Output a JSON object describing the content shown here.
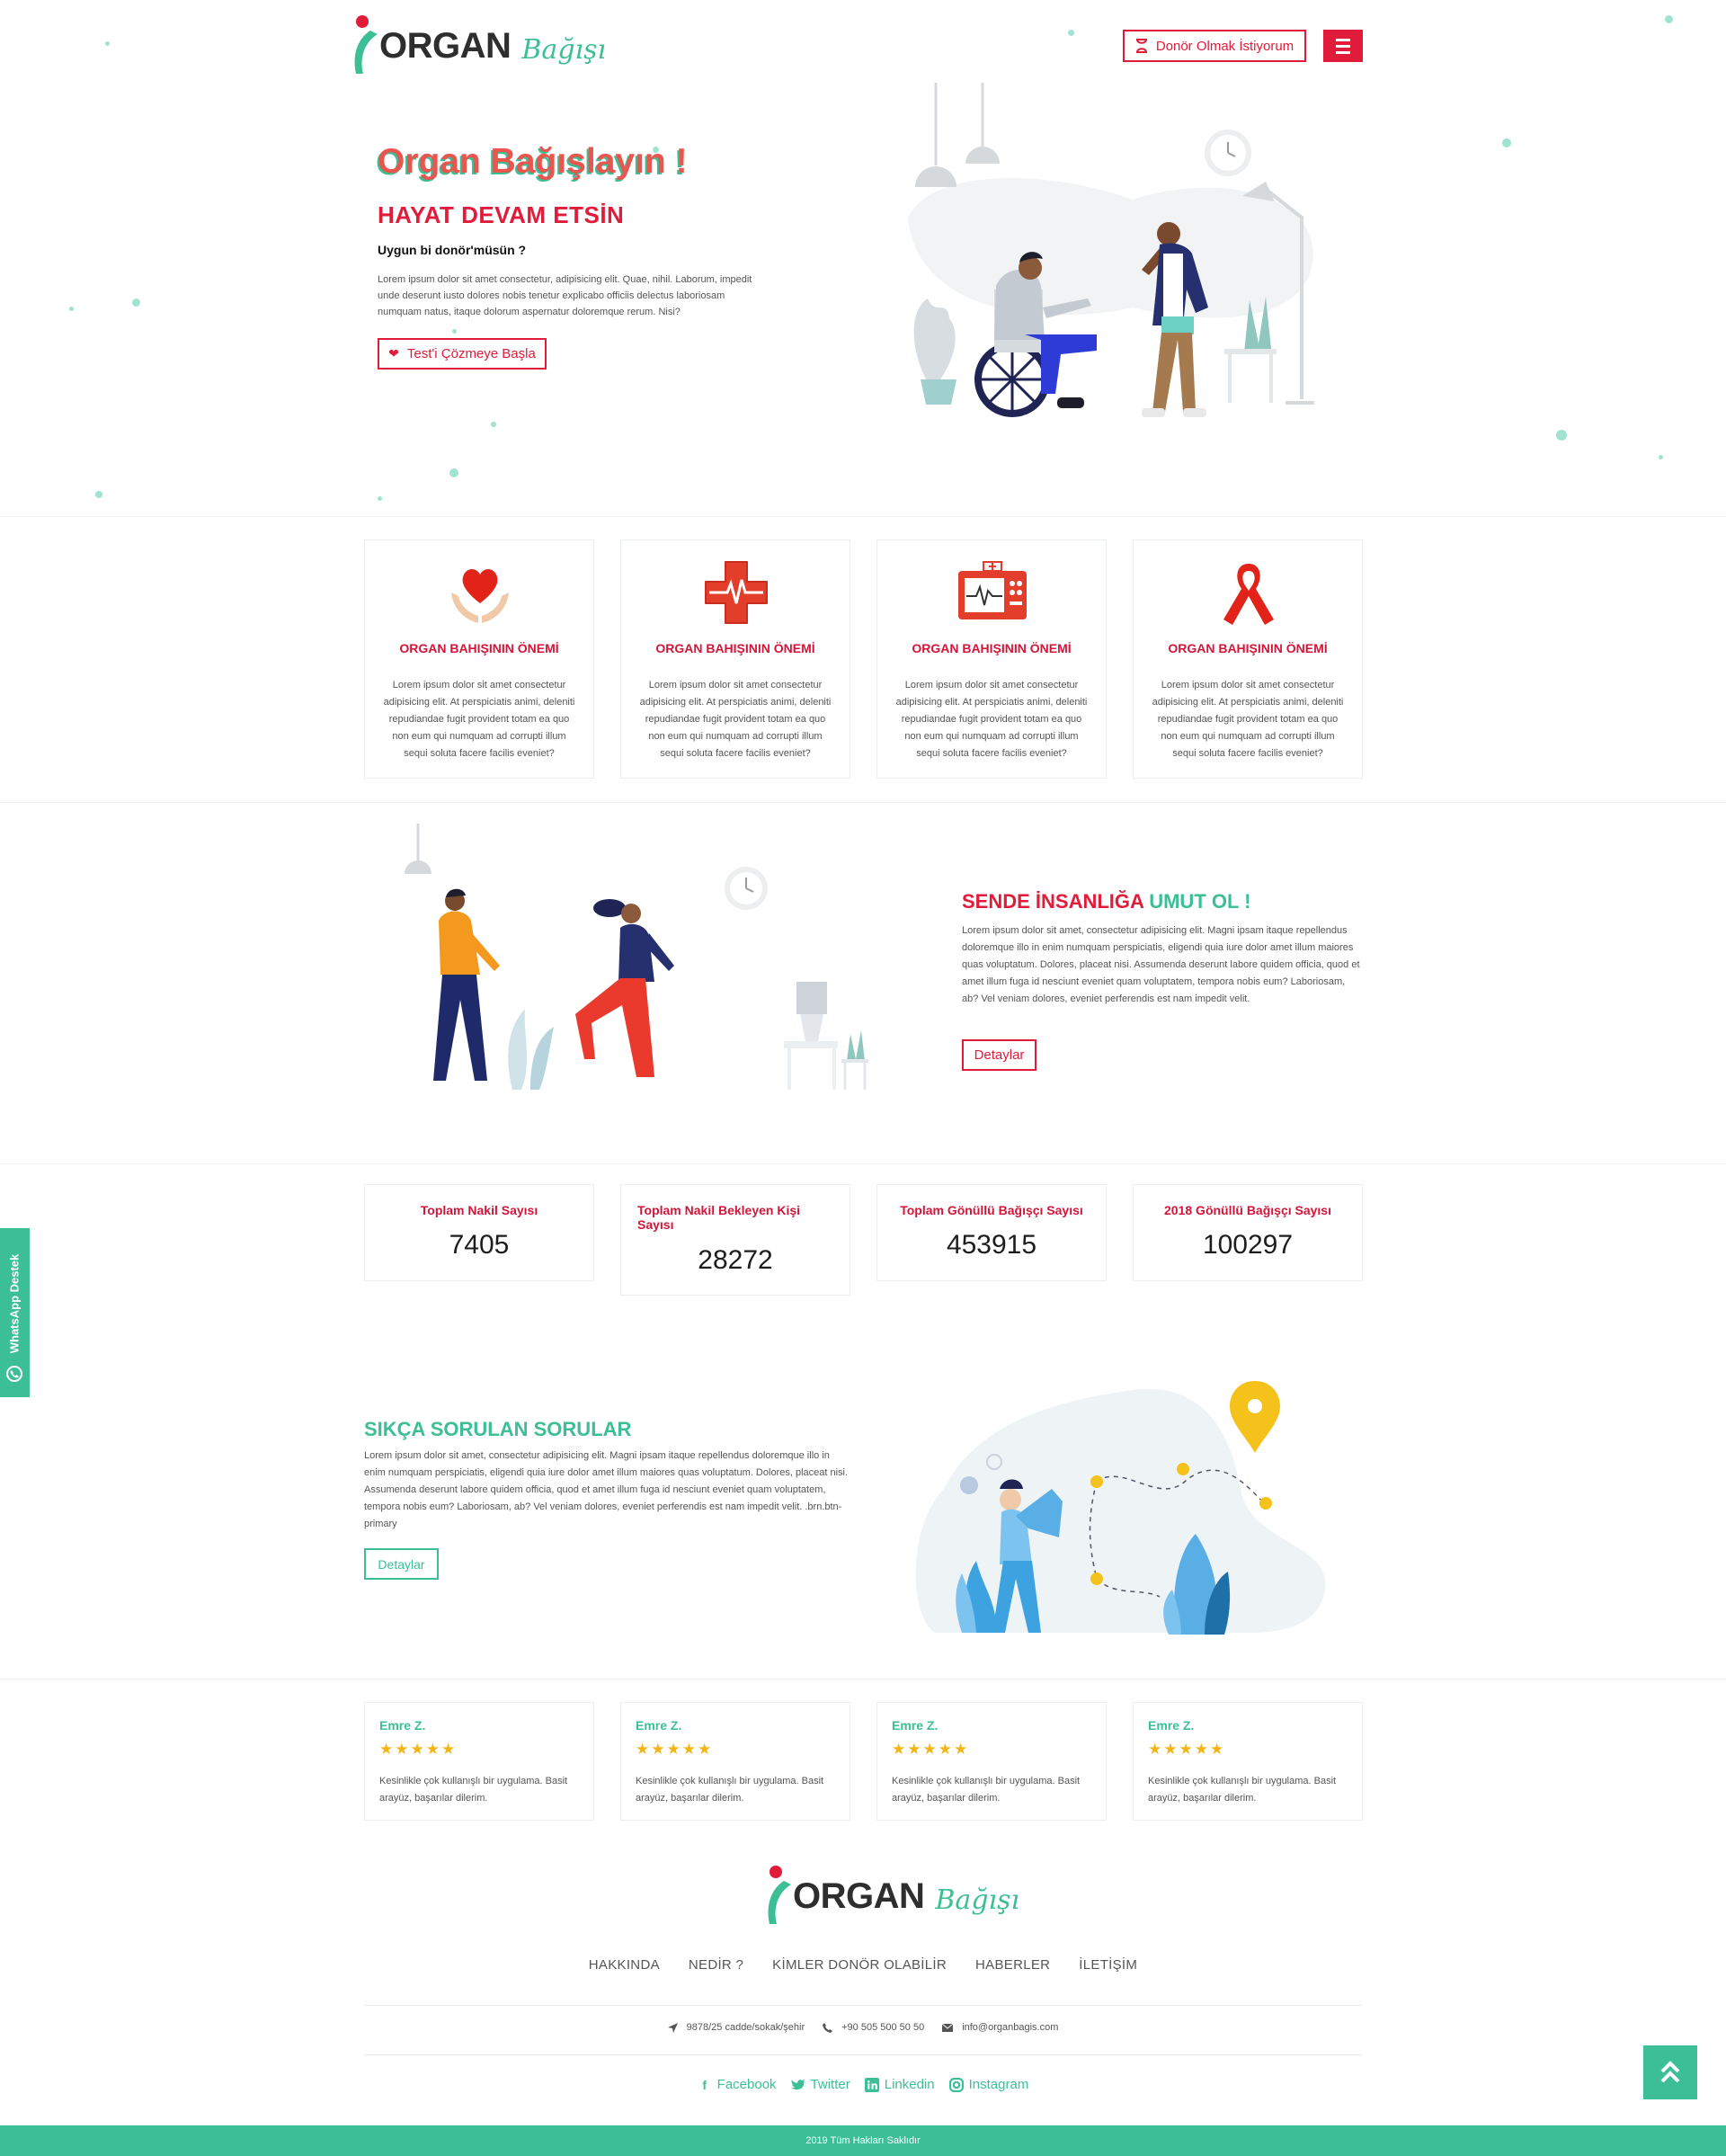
{
  "header": {
    "logo_word": "ORGAN",
    "logo_script": "Bağışı",
    "donor_button": "Donör Olmak İstiyorum",
    "colors": {
      "brand_red": "#e11b3a",
      "brand_green": "#3cbf95"
    }
  },
  "hero": {
    "title": "Organ Bağışlayın !",
    "subtitle": "HAYAT DEVAM ETSİN",
    "question": "Uygun bi donör'müsün ?",
    "paragraph": "Lorem ipsum dolor sit amet consectetur, adipisicing elit. Quae, nihil. Laborum, impedit unde deserunt iusto dolores nobis tenetur explicabo officiis delectus laboriosam numquam natus, itaque dolorum aspernatur doloremque rerum. Nisi?",
    "cta": "Test'i Çözmeye Başla"
  },
  "features": [
    {
      "icon": "heart-hands-icon",
      "title": "ORGAN BAHIŞININ ÖNEMİ",
      "text": "Lorem ipsum dolor sit amet consectetur adipisicing elit. At perspiciatis animi, deleniti repudiandae fugit provident totam ea quo non eum qui numquam ad corrupti illum sequi soluta facere facilis eveniet?"
    },
    {
      "icon": "medical-cross-icon",
      "title": "ORGAN BAHIŞININ ÖNEMİ",
      "text": "Lorem ipsum dolor sit amet consectetur adipisicing elit. At perspiciatis animi, deleniti repudiandae fugit provident totam ea quo non eum qui numquam ad corrupti illum sequi soluta facere facilis eveniet?"
    },
    {
      "icon": "heart-monitor-icon",
      "title": "ORGAN BAHIŞININ ÖNEMİ",
      "text": "Lorem ipsum dolor sit amet consectetur adipisicing elit. At perspiciatis animi, deleniti repudiandae fugit provident totam ea quo non eum qui numquam ad corrupti illum sequi soluta facere facilis eveniet?"
    },
    {
      "icon": "awareness-ribbon-icon",
      "title": "ORGAN BAHIŞININ ÖNEMİ",
      "text": "Lorem ipsum dolor sit amet consectetur adipisicing elit. At perspiciatis animi, deleniti repudiandae fugit provident totam ea quo non eum qui numquam ad corrupti illum sequi soluta facere facilis eveniet?"
    }
  ],
  "mission": {
    "title_part1": "SENDE İNSANLIĞA",
    "title_part2": "UMUT OL !",
    "paragraph": "Lorem ipsum dolor sit amet, consectetur adipisicing elit. Magni ipsam itaque repellendus doloremque illo in enim numquam perspiciatis, eligendi quia iure dolor amet illum maiores quas voluptatum. Dolores, placeat nisi. Assumenda deserunt labore quidem officia, quod et amet illum fuga id nesciunt eveniet quam voluptatem, tempora nobis eum? Laboriosam, ab? Vel veniam dolores, eveniet perferendis est nam impedit velit.",
    "button": "Detaylar"
  },
  "stats": [
    {
      "label": "Toplam Nakil Sayısı",
      "value": "7405"
    },
    {
      "label": "Toplam Nakil Bekleyen Kişi Sayısı",
      "value": "28272"
    },
    {
      "label": "Toplam Gönüllü Bağışçı Sayısı",
      "value": "453915"
    },
    {
      "label": "2018 Gönüllü Bağışçı Sayısı",
      "value": "100297"
    }
  ],
  "faq": {
    "title": "SIKÇA SORULAN SORULAR",
    "paragraph": "Lorem ipsum dolor sit amet, consectetur adipisicing elit. Magni ipsam itaque repellendus doloremque illo in enim numquam perspiciatis, eligendi quia iure dolor amet illum maiores quas voluptatum. Dolores, placeat nisi. Assumenda deserunt labore quidem officia, quod et amet illum fuga id nesciunt eveniet quam voluptatem, tempora nobis eum? Laboriosam, ab? Vel veniam dolores, eveniet perferendis est nam impedit velit. .brn.btn-primary",
    "button": "Detaylar"
  },
  "reviews": [
    {
      "name": "Emre Z.",
      "stars": "★★★★★",
      "rating": 5,
      "text": "Kesinlikle çok kullanışlı bir uygulama. Basit arayüz, başarılar dilerim."
    },
    {
      "name": "Emre Z.",
      "stars": "★★★★★",
      "rating": 5,
      "text": "Kesinlikle çok kullanışlı bir uygulama. Basit arayüz, başarılar dilerim."
    },
    {
      "name": "Emre Z.",
      "stars": "★★★★★",
      "rating": 5,
      "text": "Kesinlikle çok kullanışlı bir uygulama. Basit arayüz, başarılar dilerim."
    },
    {
      "name": "Emre Z.",
      "stars": "★★★★★",
      "rating": 5,
      "text": "Kesinlikle çok kullanışlı bir uygulama. Basit arayüz, başarılar dilerim."
    }
  ],
  "footer": {
    "nav": [
      "HAKKINDA",
      "NEDİR ?",
      "KİMLER DONÖR OLABİLİR",
      "HABERLER",
      "İLETİŞİM"
    ],
    "address": "9878/25 cadde/sokak/şehir",
    "phone": "+90 505 500 50 50",
    "email": "info@organbagis.com",
    "social": [
      {
        "label": "Facebook",
        "icon": "facebook-icon"
      },
      {
        "label": "Twitter",
        "icon": "twitter-icon"
      },
      {
        "label": "Linkedin",
        "icon": "linkedin-icon"
      },
      {
        "label": "Instagram",
        "icon": "instagram-icon"
      }
    ],
    "copyright": "2019 Tüm Hakları Saklıdır"
  },
  "whatsapp": {
    "label": "WhatsApp Destek"
  }
}
